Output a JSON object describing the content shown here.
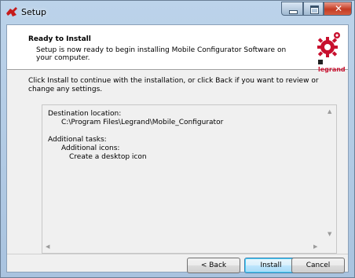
{
  "window": {
    "title": "Setup"
  },
  "header": {
    "title": "Ready to Install",
    "subtitle": "Setup is now ready to begin installing Mobile Configurator Software on your computer.",
    "logo_text": "legrand"
  },
  "intro": "Click Install to continue with the installation, or click Back if you want to review or change any settings.",
  "memo": {
    "lines": [
      "Destination location:",
      "C:\\Program Files\\Legrand\\Mobile_Configurator",
      "",
      "Additional tasks:",
      "Additional icons:",
      "Create a desktop icon"
    ]
  },
  "buttons": {
    "back": "< Back",
    "install": "Install",
    "cancel": "Cancel"
  },
  "colors": {
    "accent": "#c8102e",
    "window_frame": "#a9c3df",
    "close": "#c43b23"
  }
}
